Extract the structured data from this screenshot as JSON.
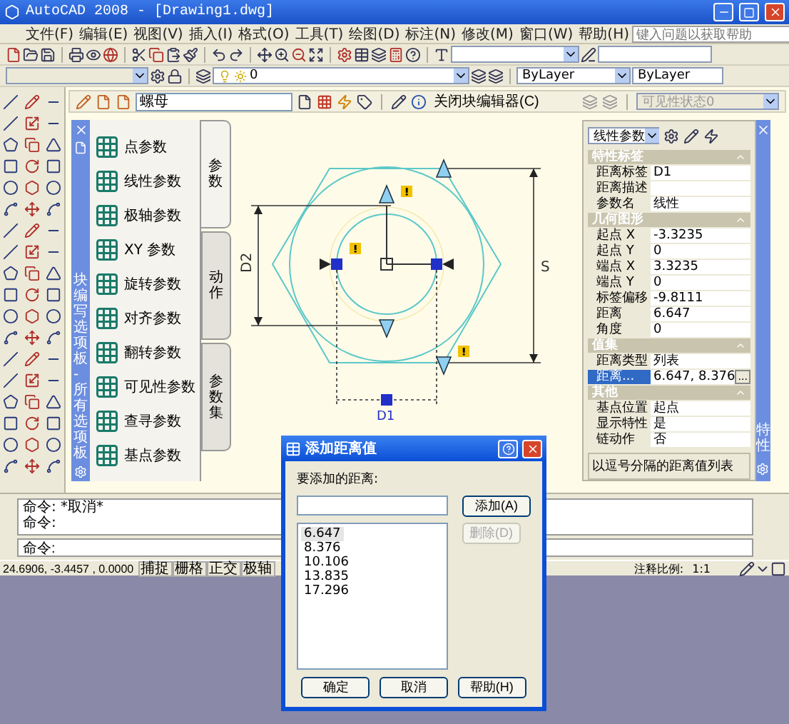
{
  "window": {
    "title": "AutoCAD 2008 - [Drawing1.dwg]"
  },
  "menu": {
    "items": [
      "文件(F)",
      "编辑(E)",
      "视图(V)",
      "插入(I)",
      "格式(O)",
      "工具(T)",
      "绘图(D)",
      "标注(N)",
      "修改(M)",
      "窗口(W)",
      "帮助(H)"
    ],
    "help_search": {
      "placeholder": "键入问题以获取帮助"
    }
  },
  "layers_toolbar": {
    "layer": "0",
    "object_colour": "ByLayer",
    "linetype": "ByLayer"
  },
  "block_editor": {
    "block_name": "螺母",
    "close_button": "关闭块编辑器(C)",
    "visibility_state": {
      "value": "可见性状态0",
      "disabled": true
    }
  },
  "authoring_palette": {
    "title": "块编写选项板 - 所有选项板",
    "items": [
      "点参数",
      "线性参数",
      "极轴参数",
      "XY 参数",
      "旋转参数",
      "对齐参数",
      "翻转参数",
      "可见性参数",
      "查寻参数",
      "基点参数"
    ],
    "tabs": [
      {
        "label": "参数",
        "selected": true
      },
      {
        "label": "动作",
        "selected": false
      },
      {
        "label": "参数集",
        "selected": false
      }
    ]
  },
  "drawing": {
    "dimension_labels": [
      "D2",
      "S",
      "D1"
    ]
  },
  "properties": {
    "title": "特性",
    "object_type": "线性参数",
    "sections": [
      {
        "title": "特性标签",
        "expanded": true,
        "rows": [
          {
            "label": "距离标签",
            "value": "D1",
            "selected": false
          },
          {
            "label": "距离描述",
            "selected": false
          },
          {
            "label": "参数名",
            "value": "线性",
            "selected": false
          }
        ]
      },
      {
        "title": "几何图形",
        "expanded": true,
        "rows": [
          {
            "label": "起点 X",
            "value": "-3.3235",
            "selected": false
          },
          {
            "label": "起点 Y",
            "value": "0",
            "selected": false
          },
          {
            "label": "端点 X",
            "value": "3.3235",
            "selected": false
          },
          {
            "label": "端点 Y",
            "value": "0",
            "selected": false
          },
          {
            "label": "标签偏移",
            "value": "-9.8111",
            "selected": false
          },
          {
            "label": "距离",
            "value": "6.647",
            "selected": false
          },
          {
            "label": "角度",
            "value": "0",
            "selected": false
          }
        ]
      },
      {
        "title": "值集",
        "expanded": true,
        "rows": [
          {
            "label": "距离类型",
            "value": "列表",
            "selected": false
          },
          {
            "label": "距离...",
            "value": "6.647, 8.376",
            "button": "...",
            "selected": true
          }
        ]
      },
      {
        "title": "其他",
        "expanded": true,
        "rows": [
          {
            "label": "基点位置",
            "value": "起点",
            "selected": false
          },
          {
            "label": "显示特性",
            "value": "是",
            "selected": false
          },
          {
            "label": "链动作",
            "value": "否",
            "selected": false
          }
        ]
      }
    ],
    "description": "以逗号分隔的距离值列表"
  },
  "command_line": {
    "history": [
      "命令: *取消*",
      "命令:"
    ],
    "prompt": "命令:"
  },
  "status_bar": {
    "coordinates": "24.6906, -3.4457 , 0.0000",
    "toggles": [
      "捕捉",
      "栅格",
      "正交",
      "极轴"
    ],
    "annotation_scale_label": "注释比例:",
    "annotation_scale": "1:1"
  },
  "dialog": {
    "title": "添加距离值",
    "field_label": "要添加的距离:",
    "add_button": {
      "label": "添加(A)",
      "disabled": false
    },
    "delete_button": {
      "label": "删除(D)",
      "disabled": true
    },
    "values": [
      {
        "text": "6.647",
        "selected": true
      },
      {
        "text": "8.376",
        "selected": false
      },
      {
        "text": "10.106",
        "selected": false
      },
      {
        "text": "13.835",
        "selected": false
      },
      {
        "text": "17.296",
        "selected": false
      }
    ],
    "buttons": [
      "确定",
      "取消",
      "帮助(H)"
    ]
  }
}
